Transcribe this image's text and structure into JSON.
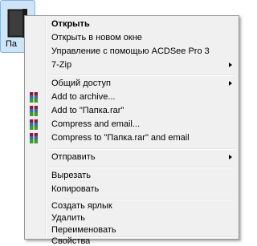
{
  "desktop": {
    "folder_label": "Па"
  },
  "menu": {
    "items": [
      {
        "label": "Открыть",
        "bold": true
      },
      {
        "label": "Открыть в новом окне"
      },
      {
        "label": "Управление с помощью ACDSee Pro 3"
      },
      {
        "label": "7-Zip",
        "submenu": true
      },
      {
        "label": "Общий доступ",
        "submenu": true
      },
      {
        "label": "Add to archive...",
        "icon": "winrar-icon"
      },
      {
        "label": "Add to \"Папка.rar\"",
        "icon": "winrar-icon"
      },
      {
        "label": "Compress and email...",
        "icon": "winrar-icon"
      },
      {
        "label": "Compress to \"Папка.rar\" and email",
        "icon": "winrar-icon"
      },
      {
        "label": "Отправить",
        "submenu": true
      },
      {
        "label": "Вырезать"
      },
      {
        "label": "Копировать"
      },
      {
        "label": "Создать ярлык"
      },
      {
        "label": "Удалить"
      },
      {
        "label": "Переименовать"
      },
      {
        "label": "Свойства"
      }
    ]
  },
  "colors": {
    "menu_bg": "#f0f0f0",
    "menu_border": "#979797",
    "selection": "#cfe4f7"
  }
}
